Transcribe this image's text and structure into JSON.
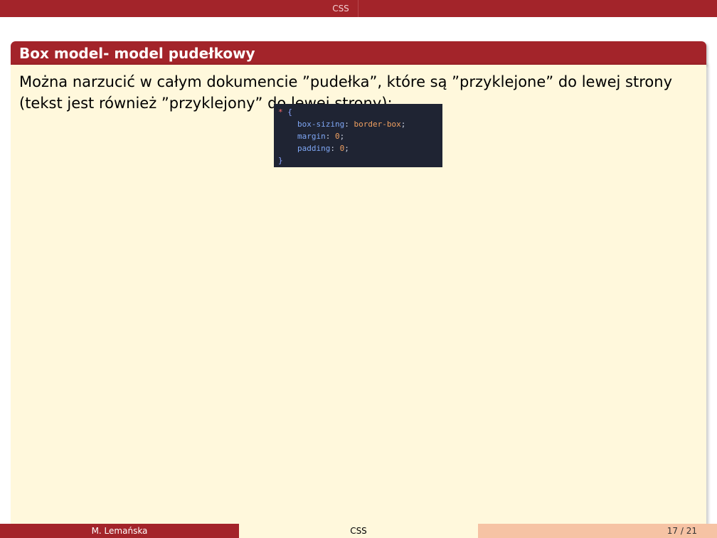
{
  "header": {
    "section": "CSS"
  },
  "block": {
    "title": "Box model- model pudełkowy",
    "text": "Można narzucić w całym dokumencie ”pudełka”, które są ”przyklejone” do lewej strony (tekst jest również ”przyklejony” do lewej strony):"
  },
  "code": {
    "selector": "*",
    "open_brace": "{",
    "close_brace": "}",
    "declarations": [
      {
        "prop": "box-sizing",
        "value": "border-box"
      },
      {
        "prop": "margin",
        "value": "0"
      },
      {
        "prop": "padding",
        "value": "0"
      }
    ]
  },
  "footer": {
    "author": "M. Lemańska",
    "title": "CSS",
    "page": "17 / 21"
  }
}
